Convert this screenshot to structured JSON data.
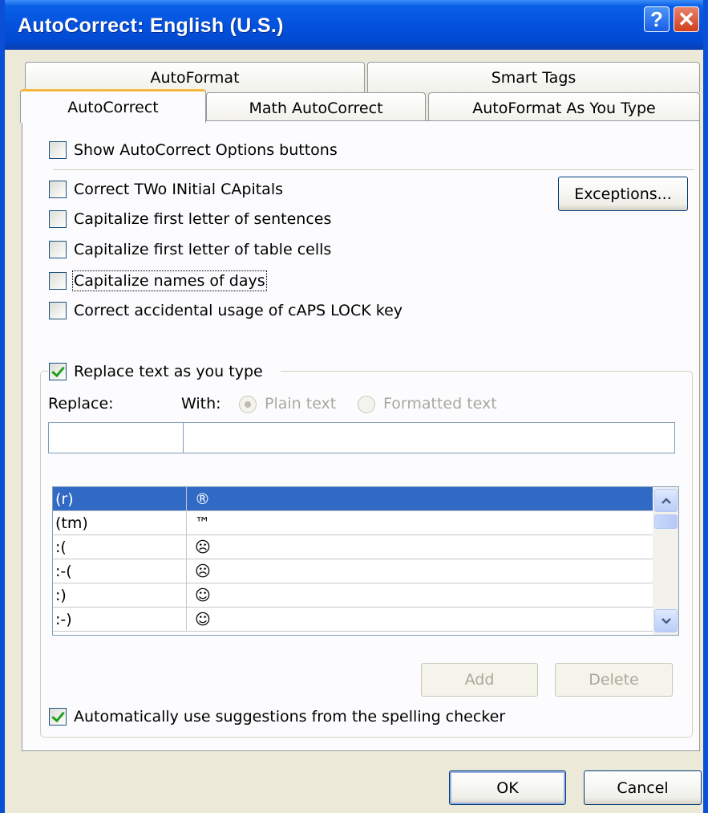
{
  "window": {
    "title": "AutoCorrect: English (U.S.)",
    "help": "?",
    "close": "✕"
  },
  "tabs": {
    "row1": [
      {
        "label": "AutoFormat"
      },
      {
        "label": "Smart Tags"
      }
    ],
    "row2": [
      {
        "label": "AutoCorrect"
      },
      {
        "label": "Math AutoCorrect"
      },
      {
        "label": "AutoFormat As You Type"
      }
    ],
    "active": "AutoCorrect"
  },
  "options": {
    "show_buttons": {
      "label": "Show AutoCorrect Options buttons",
      "checked": false
    },
    "two_initial": {
      "label": "Correct TWo INitial CApitals",
      "checked": false
    },
    "sentences": {
      "label": "Capitalize first letter of sentences",
      "checked": false
    },
    "table_cells": {
      "label": "Capitalize first letter of table cells",
      "checked": false
    },
    "days": {
      "label": "Capitalize names of days",
      "checked": false
    },
    "caps_lock": {
      "label": "Correct accidental usage of cAPS LOCK key",
      "checked": false
    }
  },
  "exceptions_label": "Exceptions...",
  "replace_group": {
    "toggle_label": "Replace text as you type",
    "toggle_checked": true,
    "replace_label": "Replace:",
    "with_label": "With:",
    "plain_text": "Plain text",
    "formatted_text": "Formatted text",
    "replace_value": "",
    "with_value": "",
    "rows": [
      {
        "replace": "(r)",
        "with": "®",
        "selected": true
      },
      {
        "replace": "(tm)",
        "with": "™",
        "selected": false
      },
      {
        "replace": ":(",
        "with": "☹",
        "selected": false
      },
      {
        "replace": ":-(",
        "with": "☹",
        "selected": false
      },
      {
        "replace": ":)",
        "with": "☺",
        "selected": false
      },
      {
        "replace": ":-)",
        "with": "☺",
        "selected": false
      }
    ],
    "add_label": "Add",
    "delete_label": "Delete",
    "suggestions_label": "Automatically use suggestions from the spelling checker",
    "suggestions_checked": true
  },
  "footer": {
    "ok": "OK",
    "cancel": "Cancel"
  },
  "icons": {
    "scroll_up": "up-arrow-icon",
    "scroll_down": "down-arrow-icon"
  }
}
